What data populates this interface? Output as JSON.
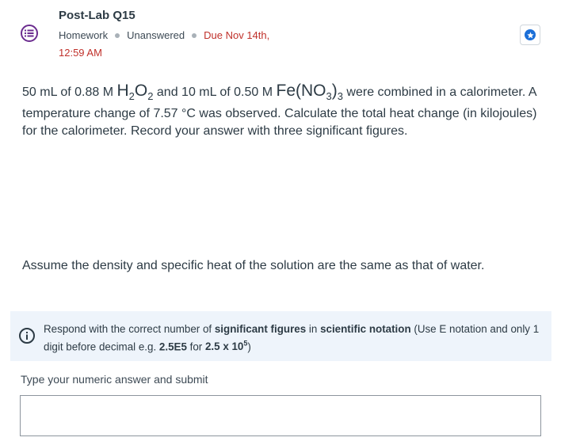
{
  "header": {
    "icon": "homework-list-icon",
    "title": "Post-Lab Q15",
    "type": "Homework",
    "status": "Unanswered",
    "due_label": "Due Nov 14th,",
    "due_time": "12:59 AM",
    "star_icon": "star-icon",
    "accent_color": "#6b2c8f",
    "due_color": "#c0312b"
  },
  "question": {
    "part1": "50 mL of 0.88 M ",
    "chem1": [
      "H",
      "2",
      "O",
      "2"
    ],
    "part2": " and 10 mL of 0.50 M ",
    "chem2": [
      "Fe(NO",
      "3",
      ")",
      "3"
    ],
    "part3": " were combined in a calorimeter.  A temperature change of 7.57 °C was observed. Calculate the total heat change (in kilojoules) for the calorimeter.  Record your answer with three significant figures.",
    "assume": "Assume the density and specific heat of the solution are the same as that of water."
  },
  "info": {
    "icon": "info-icon",
    "t1": "Respond with the correct number of ",
    "b1": "significant figures",
    "t2": " in ",
    "b2": "scientific notation",
    "t3": " (Use E notation and only 1 digit before decimal e.g. ",
    "b3": "2.5E5",
    "t4": " for ",
    "b4": "2.5 x 10",
    "b4_sup": "5",
    "t5": ")",
    "bg_color": "#eef4fb"
  },
  "answer": {
    "label": "Type your numeric answer and submit",
    "value": ""
  }
}
